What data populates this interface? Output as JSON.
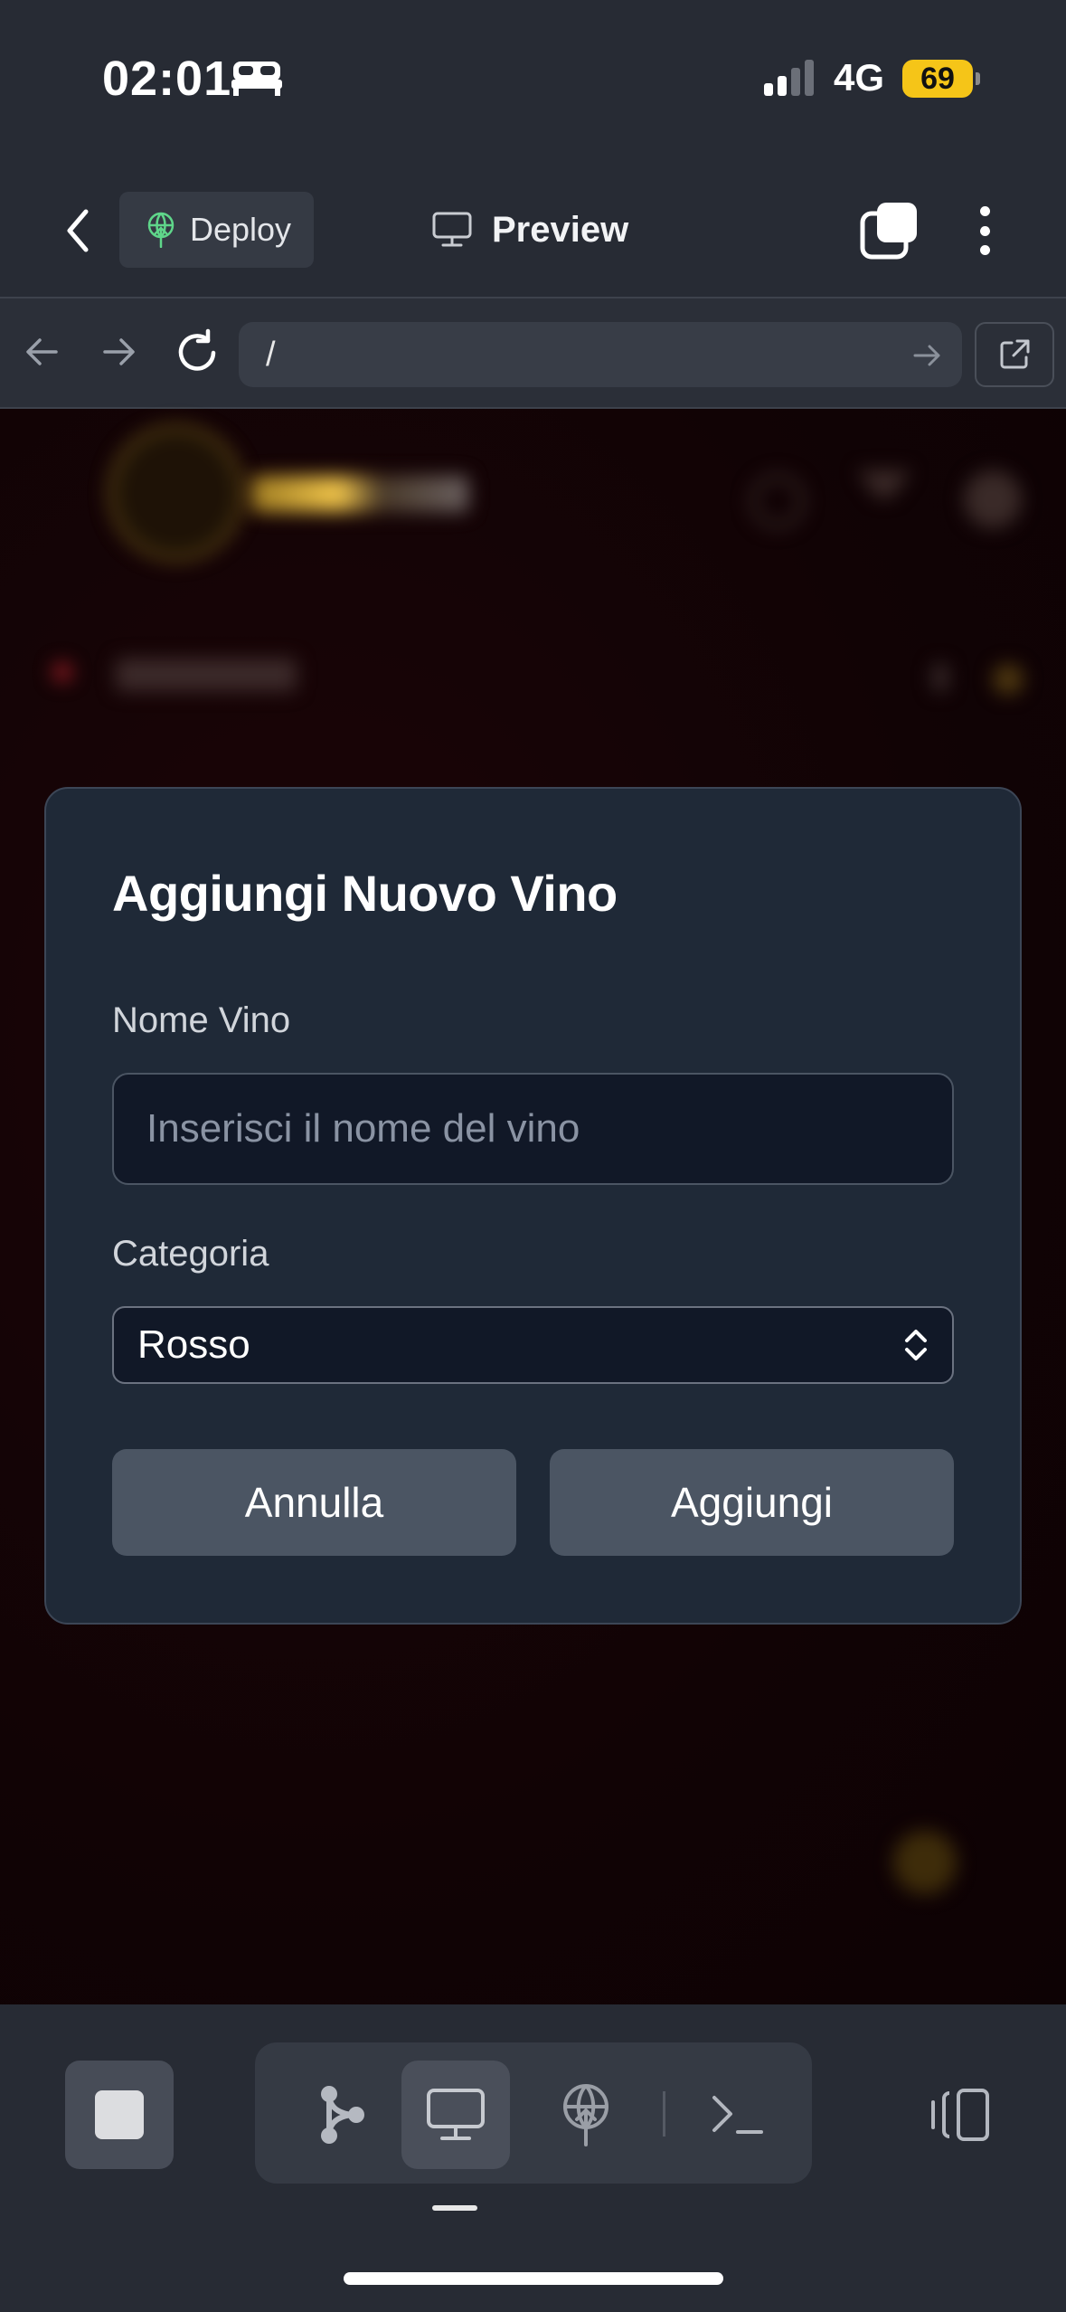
{
  "status_bar": {
    "time": "02:01",
    "network": "4G",
    "battery": "69",
    "icons": [
      "bed-icon",
      "signal-icon",
      "battery-icon"
    ]
  },
  "header": {
    "deploy_label": "Deploy",
    "preview_label": "Preview",
    "icons": [
      "chevron-left-icon",
      "deploy-icon",
      "monitor-icon",
      "tabs-icon",
      "more-vertical-icon"
    ]
  },
  "browser": {
    "url": "/",
    "icons": [
      "arrow-left-icon",
      "arrow-right-icon",
      "reload-icon",
      "go-arrow-icon",
      "open-external-icon"
    ]
  },
  "modal": {
    "title": "Aggiungi Nuovo Vino",
    "name_label": "Nome Vino",
    "name_placeholder": "Inserisci il nome del vino",
    "name_value": "",
    "category_label": "Categoria",
    "category_value": "Rosso",
    "cancel_label": "Annulla",
    "add_label": "Aggiungi"
  },
  "toolbar": {
    "icons": [
      "stop-icon",
      "workflow-icon",
      "monitor-icon",
      "deploy-icon",
      "terminal-icon",
      "split-view-icon"
    ],
    "active_tab": "preview"
  },
  "colors": {
    "app_bg": "#272b34",
    "modal_bg": "#1f2937",
    "input_bg": "#111827",
    "button_bg": "#4b5563",
    "battery": "#f5c518",
    "deploy_icon": "#5fd68a"
  }
}
